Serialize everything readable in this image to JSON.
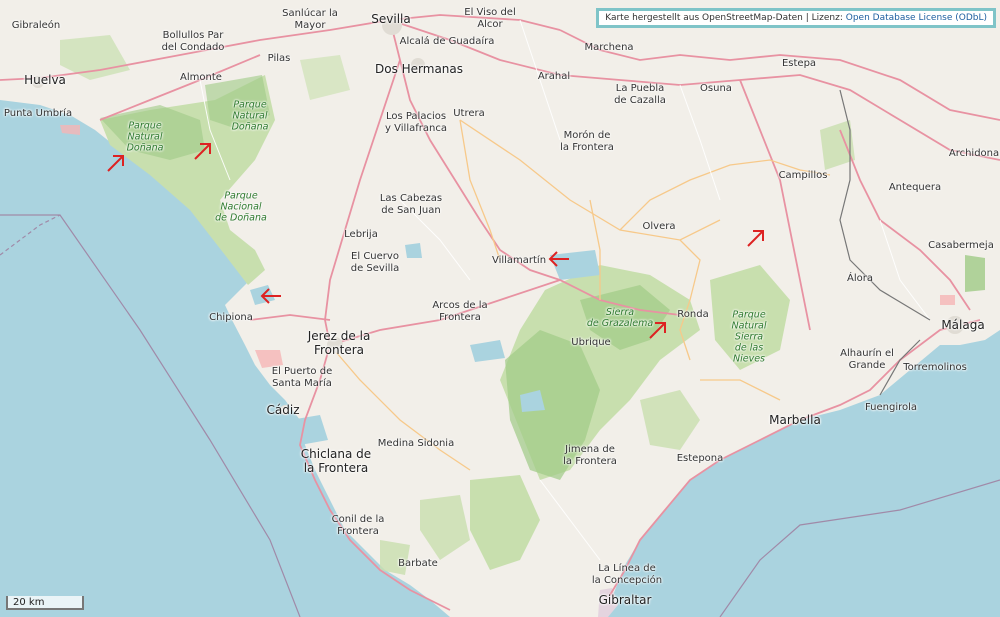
{
  "attribution": {
    "prefix": "Karte hergestellt aus OpenStreetMap-Daten | Lizenz: ",
    "license": "Open Database License (ODbL)"
  },
  "scale": {
    "label": "20 km"
  },
  "colors": {
    "sea": "#aad3df",
    "land": "#f2efe9",
    "park": "#c8dfae",
    "forest": "#9fca86",
    "primary_road": "#e892a2",
    "secondary_road": "#f7c98a",
    "border": "#a08aa8",
    "arrow": "#dd2222"
  },
  "places": [
    {
      "name": "Sevilla",
      "size": "big"
    },
    {
      "name": "Sanlúcar la\nMayor"
    },
    {
      "name": "El Viso del\nAlcor"
    },
    {
      "name": "Gibraleón"
    },
    {
      "name": "Bollullos Par\ndel Condado"
    },
    {
      "name": "Alcalá de Guadaíra"
    },
    {
      "name": "Marchena"
    },
    {
      "name": "Estepa"
    },
    {
      "name": "Huelva",
      "size": "big"
    },
    {
      "name": "Almonte"
    },
    {
      "name": "Pilas"
    },
    {
      "name": "Dos Hermanas",
      "size": "big"
    },
    {
      "name": "Arahal"
    },
    {
      "name": "La Puebla\nde Cazalla"
    },
    {
      "name": "Osuna"
    },
    {
      "name": "Punta Umbría"
    },
    {
      "name": "Utrera"
    },
    {
      "name": "Los Palacios\ny Villafranca"
    },
    {
      "name": "Morón de\nla Frontera"
    },
    {
      "name": "Archidona"
    },
    {
      "name": "Campillos"
    },
    {
      "name": "Antequera"
    },
    {
      "name": "Las Cabezas\nde San Juan"
    },
    {
      "name": "Lebrija"
    },
    {
      "name": "Olvera"
    },
    {
      "name": "Casabermeja"
    },
    {
      "name": "El Cuervo\nde Sevilla"
    },
    {
      "name": "Villamartín"
    },
    {
      "name": "Álora"
    },
    {
      "name": "Arcos de la\nFrontera"
    },
    {
      "name": "Chipiona"
    },
    {
      "name": "Ronda"
    },
    {
      "name": "Jerez de la\nFrontera",
      "size": "big"
    },
    {
      "name": "Ubrique"
    },
    {
      "name": "Málaga",
      "size": "big"
    },
    {
      "name": "El Puerto de\nSanta María"
    },
    {
      "name": "Alhaurín el\nGrande"
    },
    {
      "name": "Torremolinos"
    },
    {
      "name": "Cádiz",
      "size": "big"
    },
    {
      "name": "Fuengirola"
    },
    {
      "name": "Marbella",
      "size": "big"
    },
    {
      "name": "Medina Sidonia"
    },
    {
      "name": "Chiclana de\nla Frontera",
      "size": "big"
    },
    {
      "name": "Jimena de\nla Frontera"
    },
    {
      "name": "Estepona"
    },
    {
      "name": "Conil de la\nFrontera"
    },
    {
      "name": "Barbate"
    },
    {
      "name": "La Línea de\nla Concepción"
    },
    {
      "name": "Gibraltar",
      "size": "big"
    }
  ],
  "parks": [
    {
      "name": "Parque\nNatural\nDoñana"
    },
    {
      "name": "Parque\nNatural\nDoñana"
    },
    {
      "name": "Parque\nNacional\nde Doñana"
    },
    {
      "name": "Sierra\nde Grazalema"
    },
    {
      "name": "Parque\nNatural\nSierra\nde las\nNieves"
    }
  ],
  "markers": [
    {
      "name": "arrow-marker",
      "direction": "north-east"
    },
    {
      "name": "arrow-marker",
      "direction": "north-east"
    },
    {
      "name": "arrow-marker",
      "direction": "west"
    },
    {
      "name": "arrow-marker",
      "direction": "west"
    },
    {
      "name": "arrow-marker",
      "direction": "north-east"
    },
    {
      "name": "arrow-marker",
      "direction": "north-east"
    }
  ]
}
